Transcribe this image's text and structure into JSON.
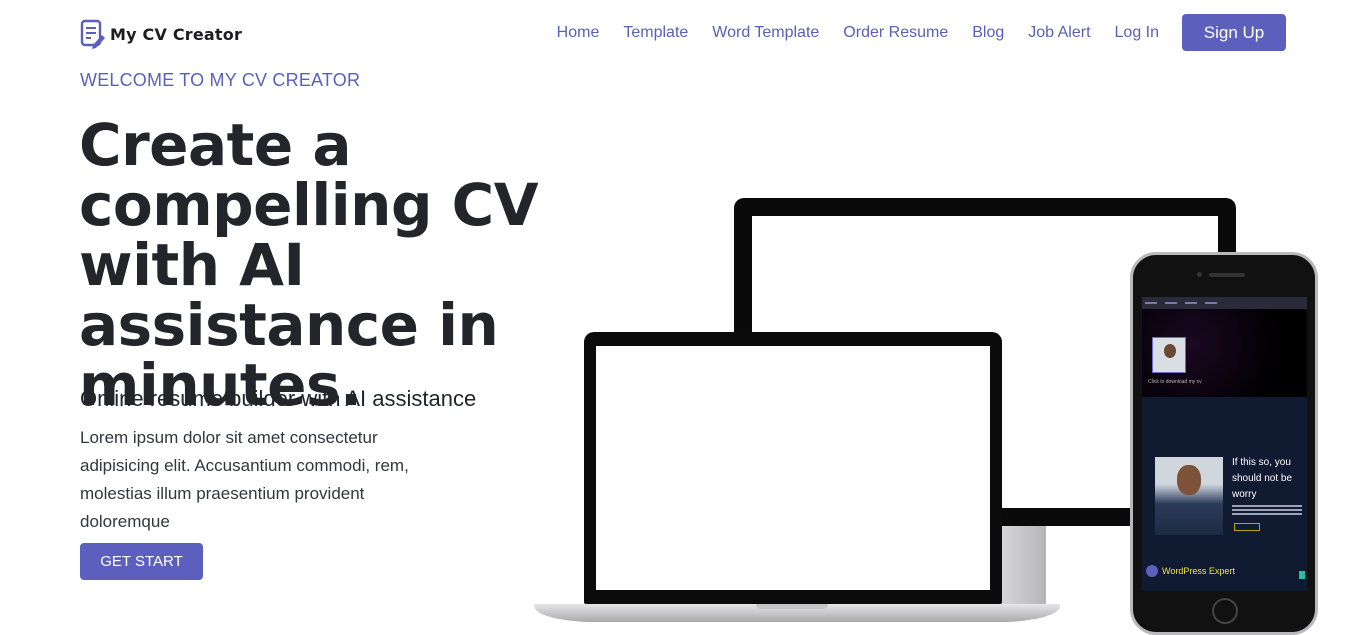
{
  "brand": {
    "name": "My CV Creator",
    "icon": "document-pen-icon"
  },
  "nav": {
    "links": [
      "Home",
      "Template",
      "Word Template",
      "Order Resume",
      "Blog",
      "Job Alert",
      "Log In"
    ],
    "signup_label": "Sign Up"
  },
  "hero": {
    "eyebrow": "WELCOME TO MY CV CREATOR",
    "title": "Create a compelling CV with AI assistance in minutes.",
    "subtitle": "Online resume builder with AI assistance",
    "body": "Lorem ipsum dolor sit amet consectetur adipisicing elit. Accusantium commodi, rem, molestias illum praesentium provident doloremque",
    "cta_label": "GET START"
  },
  "phone_preview": {
    "click_caption": "Click to download my cv",
    "headline": "If this so, you should not be worry",
    "explore": "Explore Now",
    "wordpress_badge": "WordPress Expert"
  },
  "colors": {
    "accent": "#5c5fbe",
    "text": "#23252b"
  }
}
